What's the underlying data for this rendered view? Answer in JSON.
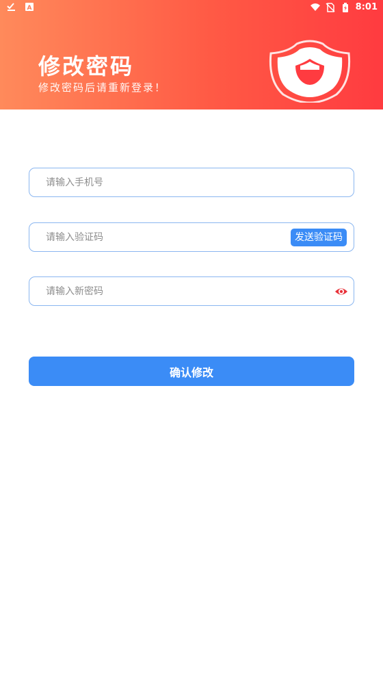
{
  "status_bar": {
    "time": "8:01",
    "left_icons": [
      "download-done-icon",
      "keyboard-a-icon"
    ],
    "right_icons": [
      "wifi-icon",
      "no-sim-icon",
      "battery-icon"
    ]
  },
  "header": {
    "title": "修改密码",
    "subtitle": "修改密码后请重新登录！",
    "illustration": "shield-icon",
    "gradient": [
      "#ff8a5b",
      "#ff3b40"
    ]
  },
  "form": {
    "phone": {
      "placeholder": "请输入手机号",
      "value": ""
    },
    "code": {
      "placeholder": "请输入验证码",
      "value": "",
      "send_label": "发送验证码"
    },
    "password": {
      "placeholder": "请输入新密码",
      "value": "",
      "toggle_icon": "eye-icon"
    },
    "submit_label": "确认修改"
  },
  "colors": {
    "accent": "#3b8cf6",
    "field_border": "#8ab6f0",
    "eye": "#e8323a"
  }
}
